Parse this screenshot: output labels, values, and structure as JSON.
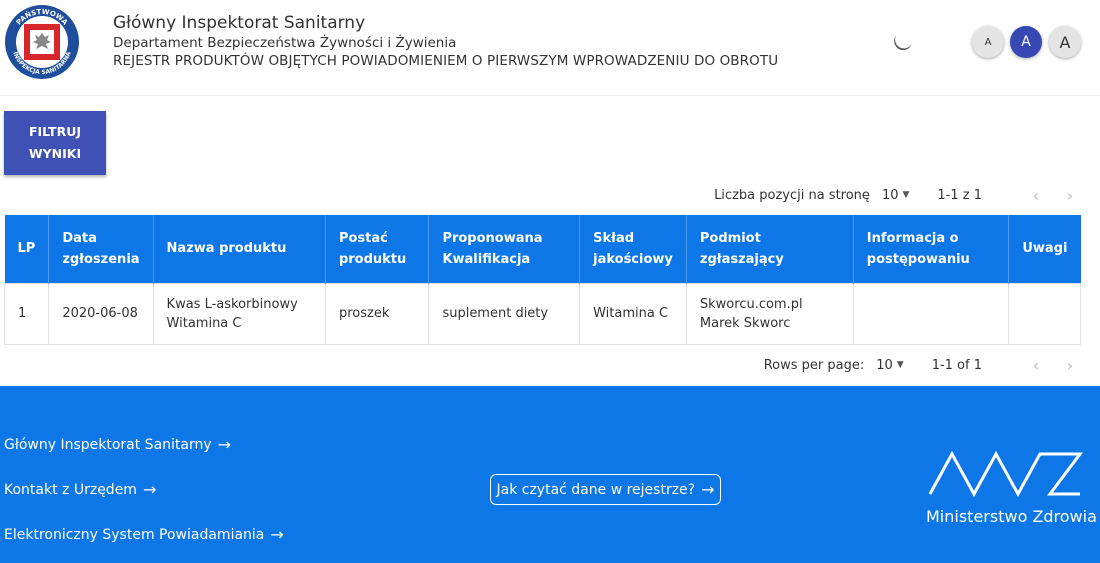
{
  "header": {
    "logo_text_top": "PAŃSTWOWA",
    "logo_text_bottom": "INSPEKCJA SANITARNA",
    "title": "Główny Inspektorat Sanitarny",
    "subtitle": "Departament Bezpieczeństwa Żywności i Żywienia",
    "register_title": "REJESTR PRODUKTÓW OBJĘTYCH POWIADOMIENIEM O PIERWSZYM WPROWADZENIU DO OBROTU",
    "font_buttons": [
      "A",
      "A",
      "A"
    ]
  },
  "filter_button": {
    "line1": "FILTRUJ",
    "line2": "WYNIKI"
  },
  "pager_top": {
    "label": "Liczba pozycji na stronę",
    "per_page": "10",
    "range": "1-1 z 1"
  },
  "pager_bottom": {
    "label": "Rows per page:",
    "per_page": "10",
    "range": "1-1 of 1"
  },
  "table": {
    "headers": [
      "LP",
      "Data zgłoszenia",
      "Nazwa produktu",
      "Postać produktu",
      "Proponowana Kwalifikacja",
      "Skład jakościowy",
      "Podmiot zgłaszający",
      "Informacja o postępowaniu",
      "Uwagi"
    ],
    "rows": [
      [
        "1",
        "2020-06-08",
        "Kwas L-askorbinowy Witamina C",
        "proszek",
        "suplement diety",
        "Witamina C",
        "Skworcu.com.pl Marek Skworc",
        "",
        ""
      ]
    ]
  },
  "footer": {
    "links": [
      "Główny Inspektorat Sanitarny",
      "Kontakt z Urzędem",
      "Elektroniczny System Powiadamiania"
    ],
    "howto": "Jak czytać dane w rejestrze?",
    "ministry": "Ministerstwo Zdrowia"
  },
  "colors": {
    "primary": "#0d77e8",
    "button": "#3f51b5",
    "active_font_button": "#3748b5"
  }
}
